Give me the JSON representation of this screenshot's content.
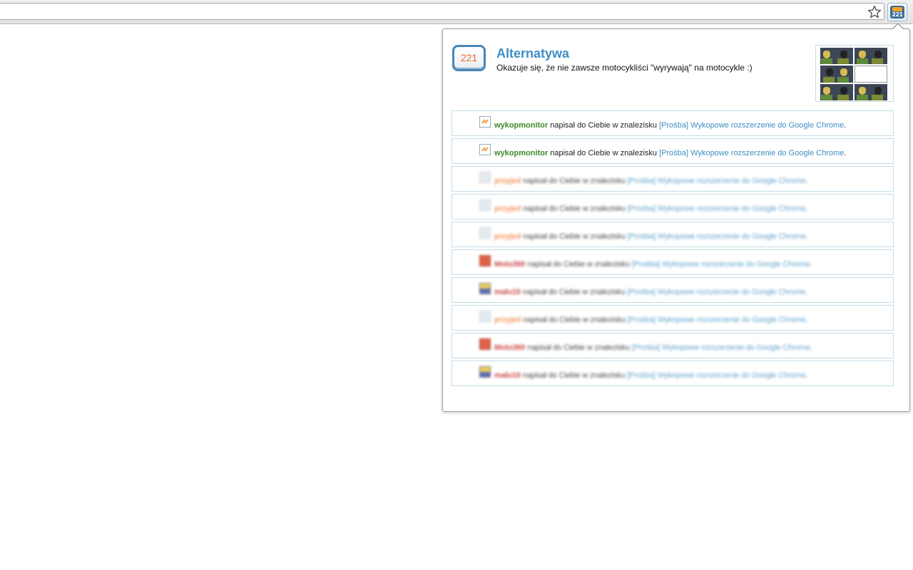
{
  "extension": {
    "badge_count": "221"
  },
  "header": {
    "counter": "221",
    "title": "Alternatywa",
    "description": "Okazuje się, że nie zawsze motocykliści \"wyrywają\" na motocykle :)"
  },
  "colors": {
    "title_blue": "#3f8ec3",
    "counter_orange": "#ee6a1f",
    "user_green": "#3f8a2a",
    "user_orange": "#f2803a",
    "user_red": "#c02020"
  },
  "notifications": [
    {
      "user": "wykopmonitor",
      "action": "napisał do Ciebie w znalezisku",
      "thread": "[Prośba] Wykopowe rozszerzenie do Google Chrome",
      "end": ".",
      "user_color": "green",
      "blurred": false
    },
    {
      "user": "wykopmonitor",
      "action": "napisał do Ciebie w znalezisku",
      "thread": "[Prośba] Wykopowe rozszerzenie do Google Chrome",
      "end": ".",
      "user_color": "green",
      "blurred": false
    },
    {
      "user": "przyjed",
      "action": "napisał do Ciebie w znalezisku",
      "thread": "[Prośba] Wykopowe rozszerzenie do Google Chrome",
      "end": ".",
      "user_color": "orange",
      "blurred": true
    },
    {
      "user": "przyjed",
      "action": "napisał do Ciebie w znalezisku",
      "thread": "[Prośba] Wykopowe rozszerzenie do Google Chrome",
      "end": ".",
      "user_color": "orange",
      "blurred": true
    },
    {
      "user": "przyjed",
      "action": "napisał do Ciebie w znalezisku",
      "thread": "[Prośba] Wykopowe rozszerzenie do Google Chrome",
      "end": ".",
      "user_color": "orange",
      "blurred": true
    },
    {
      "user": "Moto360",
      "action": "napisał do Ciebie w znalezisku",
      "thread": "[Prośba] Wykopowe rozszerzenie do Google Chrome",
      "end": ".",
      "user_color": "red",
      "blurred": true
    },
    {
      "user": "malu10",
      "action": "napisał do Ciebie w znalezisku",
      "thread": "[Prośba] Wykopowe rozszerzenie do Google Chrome",
      "end": ".",
      "user_color": "red",
      "blurred": true
    },
    {
      "user": "przyjed",
      "action": "napisał do Ciebie w znalezisku",
      "thread": "[Prośba] Wykopowe rozszerzenie do Google Chrome",
      "end": ".",
      "user_color": "orange",
      "blurred": true
    },
    {
      "user": "Moto360",
      "action": "napisał do Ciebie w znalezisku",
      "thread": "[Prośba] Wykopowe rozszerzenie do Google Chrome",
      "end": ".",
      "user_color": "red",
      "blurred": true
    },
    {
      "user": "malu10",
      "action": "napisał do Ciebie w znalezisku",
      "thread": "[Prośba] Wykopowe rozszerzenie do Google Chrome",
      "end": ".",
      "user_color": "red",
      "blurred": true
    }
  ]
}
